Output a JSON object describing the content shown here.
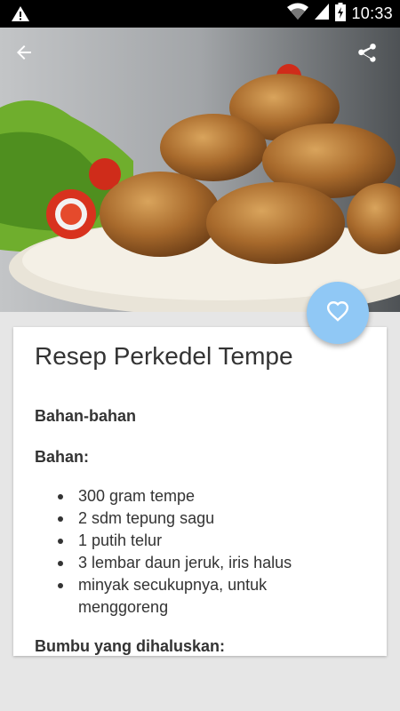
{
  "status_bar": {
    "time": "10:33",
    "icons": [
      "warning-icon",
      "wifi-icon",
      "cell-signal-icon",
      "battery-icon"
    ]
  },
  "app_bar": {
    "back_icon": "arrow-back-icon",
    "share_icon": "share-icon"
  },
  "hero": {
    "image": "fried tempe patties on a plate with lettuce and chili"
  },
  "fab": {
    "icon": "heart-outline-icon",
    "color": "#90c8f5"
  },
  "recipe": {
    "title": "Resep Perkedel Tempe",
    "section_heading": "Bahan-bahan",
    "subheading_ingredients": "Bahan:",
    "ingredients": [
      "300 gram tempe",
      "2 sdm tepung sagu",
      "1 putih telur",
      "3 lembar daun jeruk, iris halus",
      "minyak secukupnya, untuk menggoreng"
    ],
    "subheading_spices": "Bumbu yang dihaluskan:"
  }
}
